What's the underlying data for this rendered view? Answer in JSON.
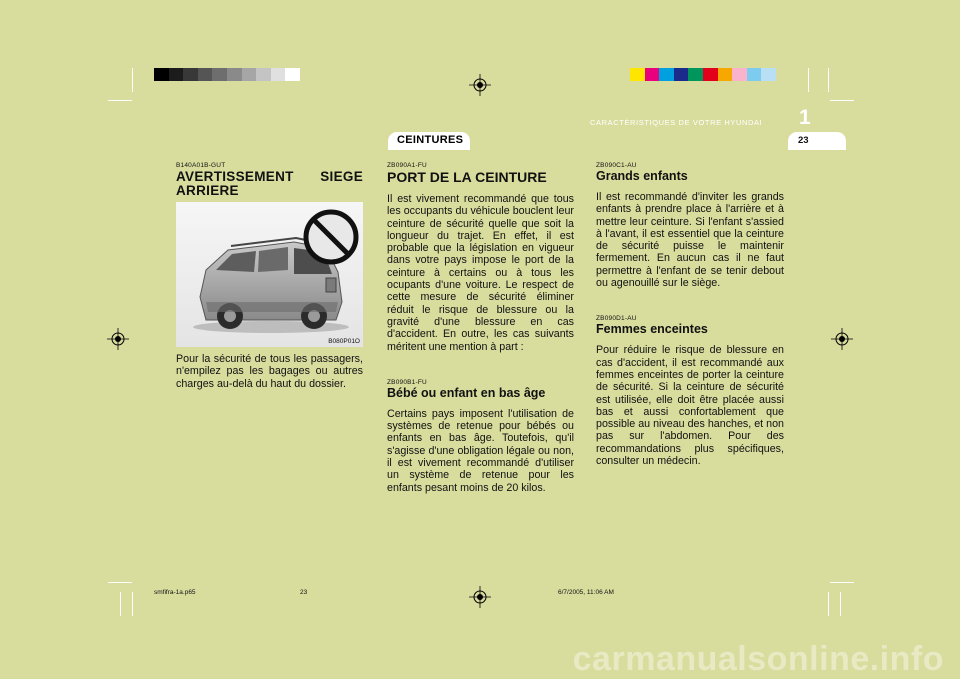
{
  "header": {
    "chapter_title": "CARACTÉRISTIQUES DE VOTRE HYUNDAI",
    "chapter_number": "1",
    "page_number": "23",
    "section_tab": "CEINTURES"
  },
  "colors": {
    "page_background": "#d8dd9e",
    "grayscale_bar": [
      "#000000",
      "#1c1c1c",
      "#383838",
      "#555555",
      "#6e6e6e",
      "#8a8a8a",
      "#a6a6a6",
      "#c4c4c4",
      "#e0e0e0",
      "#ffffff"
    ],
    "color_bar": [
      "#ffe600",
      "#e8007d",
      "#00a0e0",
      "#1a2b8c",
      "#00955a",
      "#e2001a",
      "#f6a800",
      "#f9b4cc",
      "#7ecbf0",
      "#b9dff5"
    ]
  },
  "left_col": {
    "code": "B140A01B-GUT",
    "title": "AVERTISSEMENT SIEGE ARRIERE",
    "image_code": "B080P01O",
    "body": "Pour la sécurité de tous les passagers, n'empilez pas les bagages ou autres charges au-delà du haut du dossier."
  },
  "mid_col": {
    "sec1": {
      "code": "ZB090A1-FU",
      "title": "PORT DE LA CEINTURE",
      "body": "Il est vivement recommandé que tous les occupants du véhicule bouclent leur ceinture de sécurité quelle que soit la longueur du trajet. En effet, il est probable que la législation en vigueur dans votre pays impose le port de la ceinture à certains ou à tous les ocupants d'une voiture. Le respect de cette mesure de sécurité éliminer réduit le risque de blessure ou la gravité d'une blessure en cas d'accident. En outre, les cas suivants méritent une mention à part :"
    },
    "sec2": {
      "code": "ZB090B1-FU",
      "title": "Bébé ou enfant en bas âge",
      "body": "Certains pays imposent l'utilisation de systèmes de retenue pour bébés ou enfants en bas âge. Toutefois, qu'il s'agisse d'une obligation légale ou non, il est vivement recommandé d'utiliser un système de retenue pour les enfants pesant moins de 20 kilos."
    }
  },
  "right_col": {
    "sec1": {
      "code": "ZB090C1-AU",
      "title": "Grands enfants",
      "body": "Il est recommandé d'inviter les grands enfants à prendre place à l'arrière et à mettre leur ceinture. Si l'enfant s'assied à l'avant, il est essentiel que la ceinture de sécurité puisse le maintenir fermement. En aucun cas il ne faut permettre à l'enfant de se tenir debout ou agenouillé sur le siège."
    },
    "sec2": {
      "code": "ZB090D1-AU",
      "title": "Femmes enceintes",
      "body": "Pour réduire le risque de blessure en cas d'accident, il est recommandé aux femmes enceintes de porter la ceinture de sécurité. Si la ceinture de sécurité est utilisée, elle doit être placée aussi bas et aussi confortablement que possible au niveau des hanches, et non pas sur l'abdomen. Pour des recommandations plus spécifiques, consulter un médecin."
    }
  },
  "footer": {
    "file_name": "smfifra-1a.p65",
    "file_page": "23",
    "timestamp": "6/7/2005, 11:06 AM"
  },
  "watermark": "carmanualsonline.info"
}
